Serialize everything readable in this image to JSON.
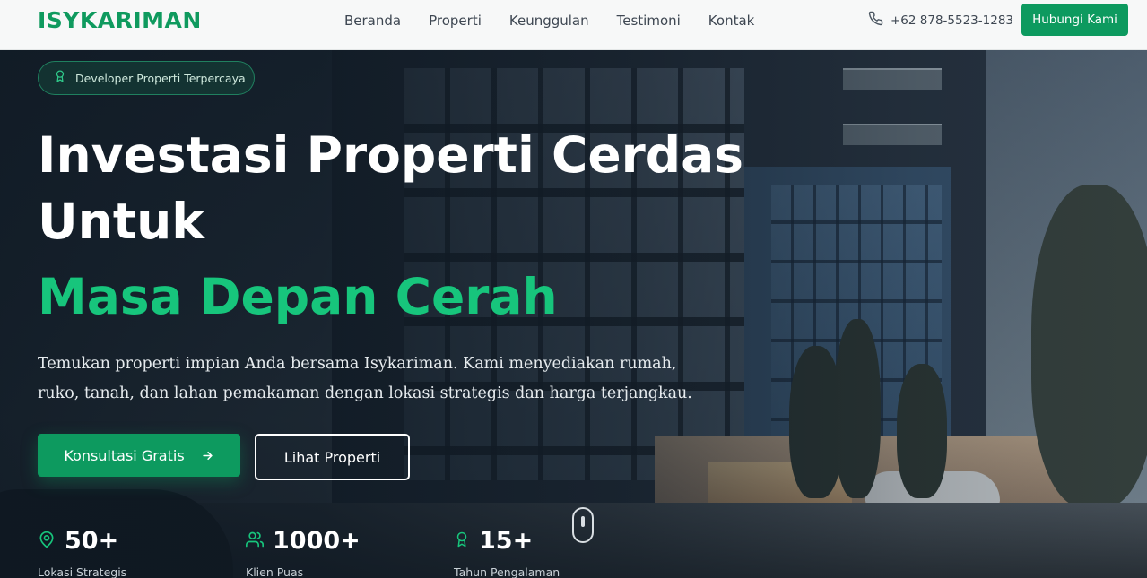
{
  "brand": {
    "logo_text": "ISYKARIMAN",
    "accent_color": "#0d9a5f",
    "highlight_color": "#17c57c"
  },
  "nav": {
    "links": [
      "Beranda",
      "Properti",
      "Keunggulan",
      "Testimoni",
      "Kontak"
    ],
    "phone": "+62 878-5523-1283",
    "cta_label": "Hubungi Kami"
  },
  "hero": {
    "badge": "Developer Properti Terpercaya",
    "title_line1": "Investasi Properti Cerdas",
    "title_line2": "Untuk",
    "title_highlight": "Masa Depan Cerah",
    "description": "Temukan properti impian Anda bersama Isykariman. Kami menyediakan rumah, ruko, tanah, dan lahan pemakaman dengan lokasi strategis dan harga terjangkau.",
    "primary_button": "Konsultasi Gratis",
    "secondary_button": "Lihat Properti"
  },
  "stats": [
    {
      "icon": "map-pin-icon",
      "value": "50+",
      "label": "Lokasi Strategis"
    },
    {
      "icon": "users-icon",
      "value": "1000+",
      "label": "Klien Puas"
    },
    {
      "icon": "award-icon",
      "value": "15+",
      "label": "Tahun Pengalaman"
    }
  ]
}
